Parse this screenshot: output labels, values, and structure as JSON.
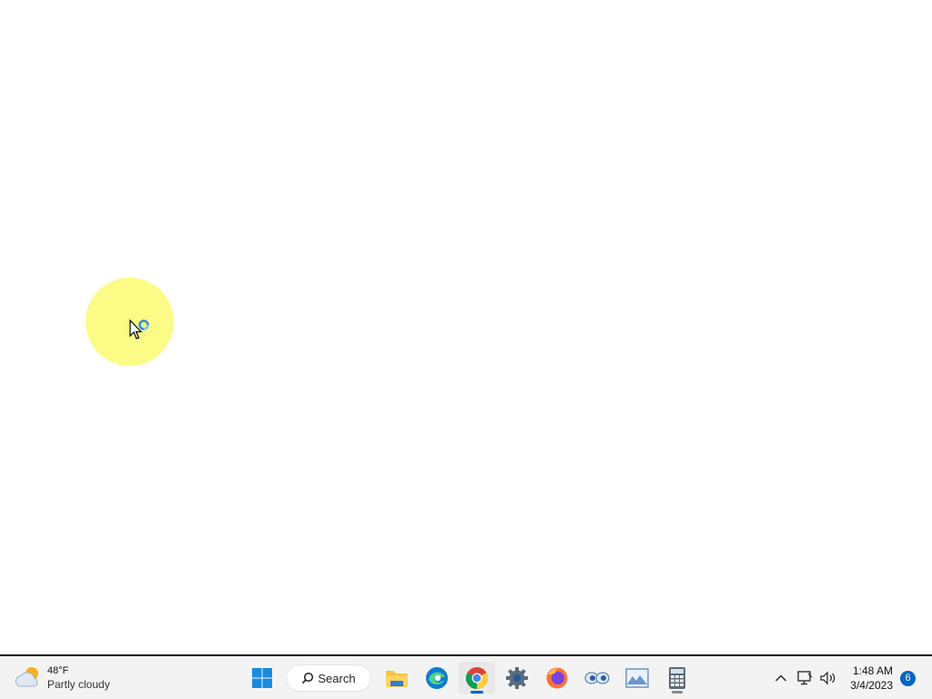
{
  "taskbar": {
    "weather": {
      "temperature": "48°F",
      "condition": "Partly cloudy",
      "icon": "partly-cloudy-icon"
    },
    "search_label": "Search",
    "apps": [
      {
        "name": "File Explorer",
        "icon": "folder-icon",
        "running": false
      },
      {
        "name": "Microsoft Edge",
        "icon": "edge-icon",
        "running": false
      },
      {
        "name": "Google Chrome",
        "icon": "chrome-icon",
        "running": true,
        "active": true
      },
      {
        "name": "Settings",
        "icon": "gear-icon",
        "running": false
      },
      {
        "name": "Firefox",
        "icon": "firefox-icon",
        "running": false
      },
      {
        "name": "Eye app",
        "icon": "eyes-icon",
        "running": false
      },
      {
        "name": "Photos",
        "icon": "image-icon",
        "running": false
      },
      {
        "name": "Calculator",
        "icon": "calculator-icon",
        "running": true
      }
    ],
    "clock": {
      "time": "1:48 AM",
      "date": "3/4/2023"
    },
    "notification_count": "6"
  },
  "colors": {
    "accent": "#0067c0",
    "cursor_highlight": "#fbfb7f",
    "taskbar_bg": "#f3f3f3"
  }
}
